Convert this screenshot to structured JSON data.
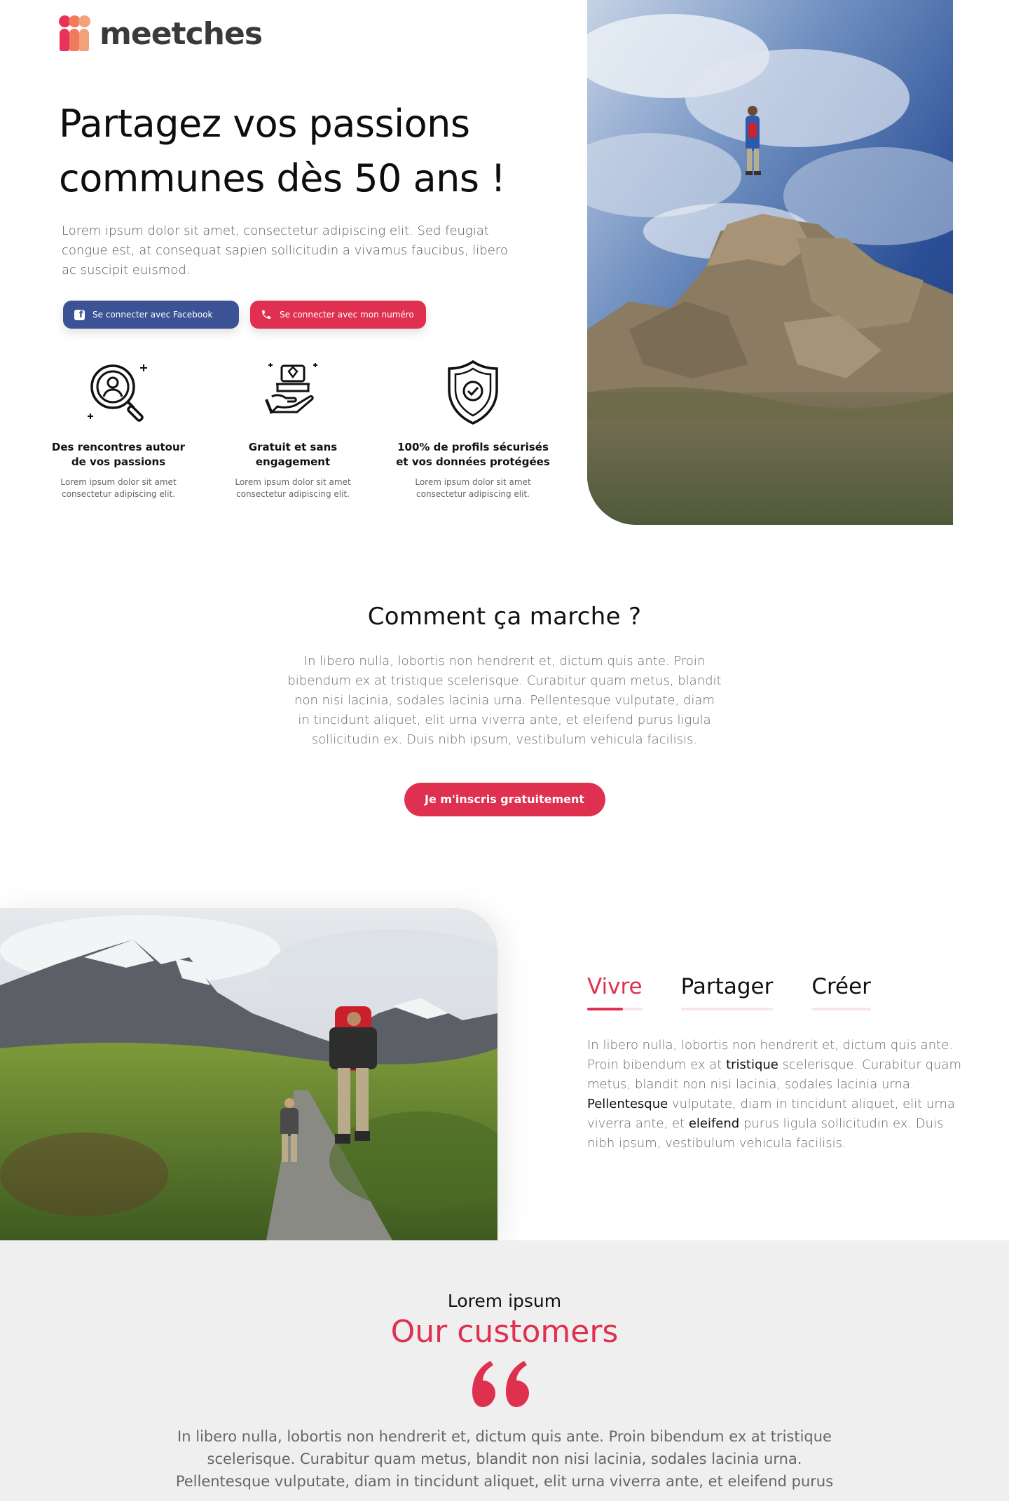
{
  "brand": {
    "name": "meetches"
  },
  "hero": {
    "title_line1": "Partagez vos passions",
    "title_line2": "communes dès 50 ans !",
    "text": "Lorem ipsum dolor sit amet, consectetur adipiscing elit. Sed feugiat congue est, at consequat sapien sollicitudin a vivamus faucibus, libero ac suscipit euismod.",
    "fb_button": "Se connecter avec Facebook",
    "phone_button": "Se connecter avec mon numéro"
  },
  "features": [
    {
      "icon": "search-person-icon",
      "title_line1": "Des rencontres autour",
      "title_line2": "de vos passions",
      "desc_line1": "Lorem ipsum dolor sit amet",
      "desc_line2": "consectetur adipiscing elit."
    },
    {
      "icon": "gift-hand-icon",
      "title_line1": "Gratuit et sans",
      "title_line2": "engagement",
      "desc_line1": "Lorem ipsum dolor sit amet",
      "desc_line2": "consectetur adipiscing elit."
    },
    {
      "icon": "shield-check-icon",
      "title_line1": "100% de profils sécurisés",
      "title_line2": "et vos données protégées",
      "desc_line1": "Lorem ipsum dolor sit amet",
      "desc_line2": "consectetur adipiscing elit."
    }
  ],
  "how": {
    "title": "Comment ça marche ?",
    "text": "In libero nulla, lobortis non hendrerit et, dictum quis ante. Proin bibendum ex at tristique scelerisque. Curabitur quam metus, blandit non nisi lacinia, sodales lacinia urna. Pellentesque vulputate, diam in tincidunt aliquet, elit urna viverra ante, et eleifend purus ligula sollicitudin ex. Duis nibh ipsum, vestibulum vehicula facilisis.",
    "cta": "Je m'inscris gratuitement"
  },
  "tabs": {
    "items": [
      "Vivre",
      "Partager",
      "Créer"
    ],
    "active": "Vivre",
    "text_parts": [
      "In libero nulla, lobortis non hendrerit et, dictum quis ante. Proin bibendum ex at ",
      "tristique",
      " scelerisque. Curabitur quam metus, blandit non nisi lacinia, sodales lacinia urna. ",
      "Pellentesque",
      " vulputate, diam in tincidunt aliquet, elit urna viverra ante, et ",
      "eleifend",
      " purus ligula sollicitudin ex. Duis nibh ipsum, vestibulum vehicula facilisis."
    ]
  },
  "customers": {
    "kicker": "Lorem ipsum",
    "title": "Our customers",
    "quote": "In libero nulla, lobortis non hendrerit et, dictum quis ante. Proin bibendum ex at tristique scelerisque. Curabitur quam metus, blandit non nisi lacinia, sodales lacinia urna. Pellentesque vulputate, diam in tincidunt aliquet, elit urna viverra ante, et eleifend purus"
  },
  "colors": {
    "accent": "#e0304f",
    "facebook": "#3b5294",
    "logo_text": "#3a3a3a",
    "section_bg": "#efefef"
  }
}
